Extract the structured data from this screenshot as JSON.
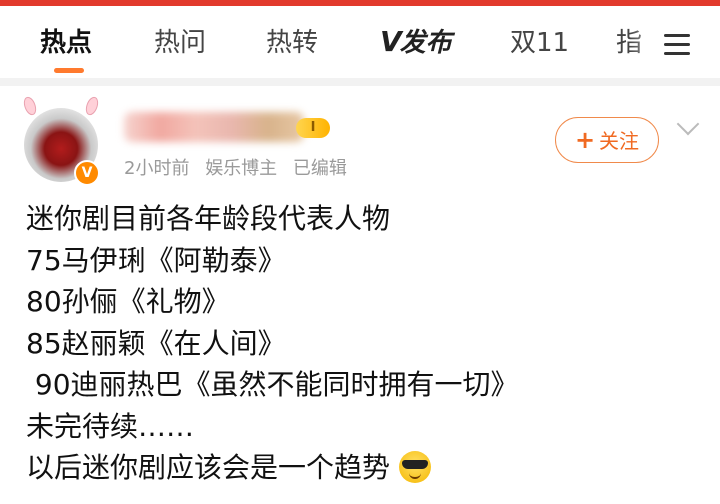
{
  "tabs": [
    {
      "label": "热点"
    },
    {
      "label": "热问"
    },
    {
      "label": "热转"
    },
    {
      "label": "发布",
      "prefix": "V"
    },
    {
      "label": "双11"
    },
    {
      "label": "指"
    }
  ],
  "post": {
    "author": {
      "time": "2小时前",
      "role": "娱乐博主",
      "edited": "已编辑",
      "vip_level": "I"
    },
    "follow_label": "关注",
    "lines": [
      "迷你剧目前各年龄段代表人物",
      "75马伊琍《阿勒泰》",
      "80孙俪《礼物》",
      "85赵丽颖《在人间》",
      " 90迪丽热巴《虽然不能同时拥有一切》",
      "未完待续……",
      "以后迷你剧应该会是一个趋势"
    ],
    "emoji": "sunglasses-face"
  },
  "colors": {
    "top_bar": "#e23a2c",
    "tab_indicator": "#ff7a2e",
    "follow": "#f06a22",
    "meta_text": "#9a9a9a"
  }
}
